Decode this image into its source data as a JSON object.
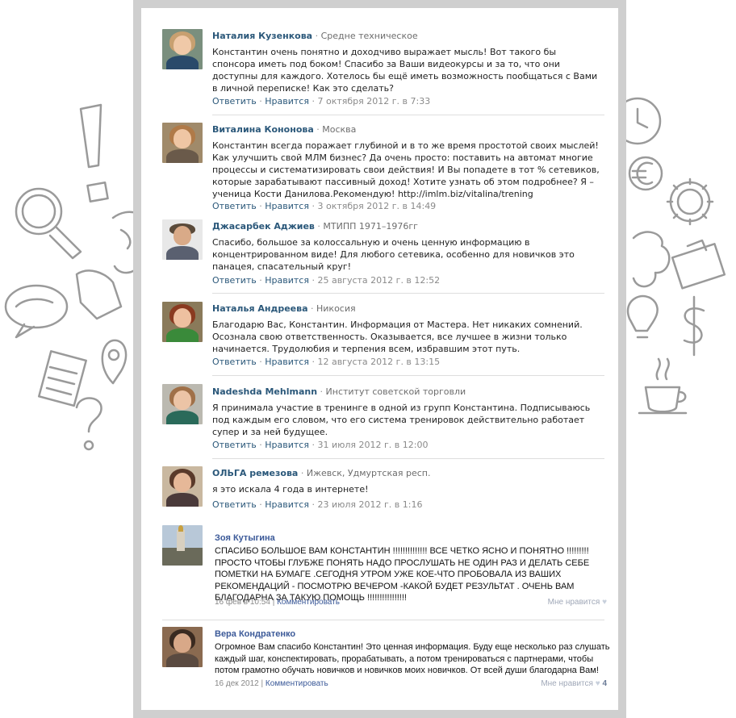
{
  "comments": [
    {
      "name": "Наталия Кузенкова",
      "meta": "Средне техническое",
      "text": "Константин очень понятно и доходчиво выражает мысль! Вот такого бы спонсора иметь под боком! Спасибо за Ваши видеокурсы и за то, что они доступны для каждого. Хотелось бы ещё иметь возможность пообщаться с Вами в личной переписке! Как это сделать?",
      "reply": "Ответить",
      "like": "Нравится",
      "date": "7 октября 2012 г. в 7:33"
    },
    {
      "name": "Виталина Кононова",
      "meta": "Москва",
      "text": "Константин всегда поражает глубиной и в то же время простотой своих мыслей! Как улучшить свой МЛМ бизнес? Да очень просто: поставить на автомат многие процессы и систематизировать свои действия! И Вы попадете в тот % сетевиков, которые зарабатывают пассивный доход! Хотите узнать об этом подробнее? Я – ученица Кости Данилова.Рекомендую! http://imlm.biz/vitalina/trening",
      "reply": "Ответить",
      "like": "Нравится",
      "date": "3 октября 2012 г. в 14:49"
    },
    {
      "name": "Джасарбек Аджиев",
      "meta": "МТИПП 1971–1976гг",
      "text": "Спасибо, большое за колоссальную и очень ценную информацию в концентрированном виде! Для любого сетевика, особенно для новичков это панацея, спасательный круг!",
      "reply": "Ответить",
      "like": "Нравится",
      "date": "25 августа 2012 г. в 12:52"
    },
    {
      "name": "Наталья Андреева",
      "meta": "Никосия",
      "text": "Благодарю Вас, Константин. Информация от Мастера. Нет никаких сомнений. Осознала свою ответственность. Оказывается, все лучшее в жизни только начинается. Трудолюбия и терпения всем, избравшим этот путь.",
      "reply": "Ответить",
      "like": "Нравится",
      "date": "12 августа 2012 г. в 13:15"
    },
    {
      "name": "Nadeshda Mehlmann",
      "meta": "Институт советской торговли",
      "text": "Я принимала участие в тренинге в одной из групп Константина. Подписываюсь под каждым его словом, что его система тренировок действительно работает супер и за ней будущее.",
      "reply": "Ответить",
      "like": "Нравится",
      "date": "31 июля 2012 г. в 12:00"
    },
    {
      "name": "ОЛЬГА ремезова",
      "meta": "Ижевск, Удмуртская респ.",
      "text": "я это искала 4 года в интернете!",
      "reply": "Ответить",
      "like": "Нравится",
      "date": "23 июля 2012 г. в 1:16"
    }
  ],
  "fb_comments": [
    {
      "name": "Зоя Кутыгина",
      "text": "СПАСИБО БОЛЬШОЕ ВАМ КОНСТАНТИН !!!!!!!!!!!!!! ВСЕ ЧЕТКО ЯСНО И ПОНЯТНО !!!!!!!!! ПРОСТО ЧТОБЫ ГЛУБЖЕ ПОНЯТЬ НАДО ПРОСЛУШАТЬ НЕ ОДИН РАЗ И ДЕЛАТЬ СЕБЕ ПОМЕТКИ НА БУМАГЕ .СЕГОДНЯ УТРОМ УЖЕ КОЕ-ЧТО ПРОБОВАЛА ИЗ ВАШИХ РЕКОМЕНДАЦИЙ - ПОСМОТРЮ ВЕЧЕРОМ -КАКОЙ БУДЕТ РЕЗУЛЬТАТ . ОЧЕНЬ ВАМ БЛАГОДАРНА ЗА ТАКУЮ ПОМОЩЬ !!!!!!!!!!!!!!!!",
      "date": "16 фев в 10:54",
      "comment": "Комментировать",
      "like": "Мне нравится",
      "like_count": ""
    },
    {
      "name": "Вера Кондратенко",
      "text": "Огромное Вам спасибо Константин! Это ценная информация. Буду еще несколько раз слушать каждый шаг, конспектировать, прорабатывать, а потом тренироваться с партнерами, чтобы потом грамотно обучать новичков и новичков моих новичков. От всей души благодарна Вам!",
      "date": "16 дек 2012",
      "comment": "Комментировать",
      "like": "Мне нравится",
      "like_count": "4"
    }
  ],
  "separator": "·",
  "pipe": "|"
}
